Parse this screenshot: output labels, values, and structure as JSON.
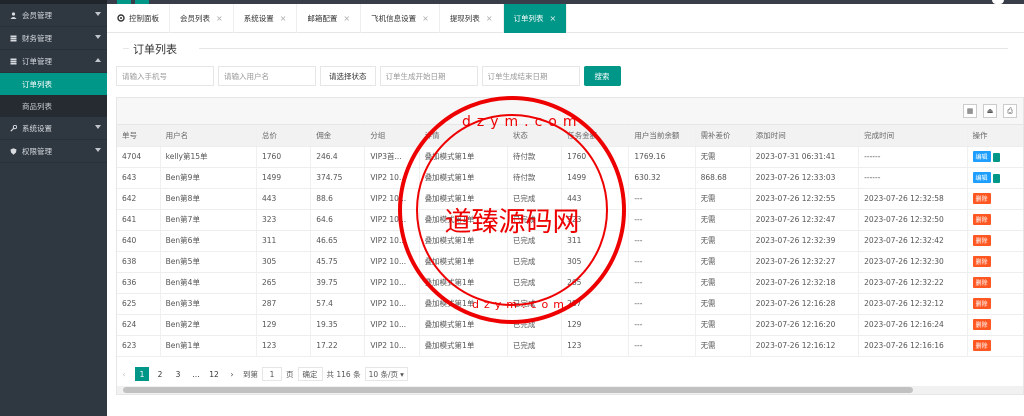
{
  "sidebar": {
    "items": [
      {
        "label": "会员管理"
      },
      {
        "label": "财务管理"
      },
      {
        "label": "订单管理"
      }
    ],
    "sub_items": [
      {
        "label": "订单列表"
      },
      {
        "label": "商品列表"
      }
    ],
    "after_items": [
      {
        "label": "系统设置"
      },
      {
        "label": "权限管理"
      }
    ]
  },
  "tabs": [
    {
      "label": "控制面板"
    },
    {
      "label": "会员列表"
    },
    {
      "label": "系统设置"
    },
    {
      "label": "邮箱配置"
    },
    {
      "label": "飞机信息设置"
    },
    {
      "label": "提现列表"
    },
    {
      "label": "订单列表"
    }
  ],
  "page": {
    "title": "订单列表"
  },
  "search": {
    "phone_placeholder": "请输入手机号",
    "user_placeholder": "请输入用户名",
    "status_label": "请选择状态",
    "start_placeholder": "订单生成开始日期",
    "end_placeholder": "订单生成结束日期",
    "submit": "搜索"
  },
  "table": {
    "headers": [
      "单号",
      "用户名",
      "总价",
      "佣金",
      "分组",
      "详情",
      "状态",
      "任务金额",
      "用户当前余额",
      "需补差价",
      "添加时间",
      "完成时间",
      "操作"
    ],
    "rows": [
      [
        "4704",
        "kelly第15单",
        "1760",
        "246.4",
        "VIP3首...",
        "叠加模式第1单",
        "待付款",
        "1760",
        "1769.16",
        "无需",
        "2023-07-31 06:31:41",
        "------"
      ],
      [
        "643",
        "Ben第9单",
        "1499",
        "374.75",
        "VIP2 10...",
        "叠加模式第1单",
        "待付款",
        "1499",
        "630.32",
        "868.68",
        "2023-07-26 12:33:03",
        "------"
      ],
      [
        "642",
        "Ben第8单",
        "443",
        "88.6",
        "VIP2 10...",
        "叠加模式第1单",
        "已完成",
        "443",
        "---",
        "无需",
        "2023-07-26 12:32:55",
        "2023-07-26 12:32:58"
      ],
      [
        "641",
        "Ben第7单",
        "323",
        "64.6",
        "VIP2 10...",
        "叠加模式第1单",
        "已完成",
        "323",
        "---",
        "无需",
        "2023-07-26 12:32:47",
        "2023-07-26 12:32:50"
      ],
      [
        "640",
        "Ben第6单",
        "311",
        "46.65",
        "VIP2 10...",
        "叠加模式第1单",
        "已完成",
        "311",
        "---",
        "无需",
        "2023-07-26 12:32:39",
        "2023-07-26 12:32:42"
      ],
      [
        "638",
        "Ben第5单",
        "305",
        "45.75",
        "VIP2 10...",
        "叠加模式第1单",
        "已完成",
        "305",
        "---",
        "无需",
        "2023-07-26 12:32:27",
        "2023-07-26 12:32:30"
      ],
      [
        "636",
        "Ben第4单",
        "265",
        "39.75",
        "VIP2 10...",
        "叠加模式第1单",
        "已完成",
        "265",
        "---",
        "无需",
        "2023-07-26 12:32:18",
        "2023-07-26 12:32:22"
      ],
      [
        "625",
        "Ben第3单",
        "287",
        "57.4",
        "VIP2 10...",
        "叠加模式第1单",
        "已完成",
        "287",
        "---",
        "无需",
        "2023-07-26 12:16:28",
        "2023-07-26 12:32:12"
      ],
      [
        "624",
        "Ben第2单",
        "129",
        "19.35",
        "VIP2 10...",
        "叠加模式第1单",
        "已完成",
        "129",
        "---",
        "无需",
        "2023-07-26 12:16:20",
        "2023-07-26 12:16:24"
      ],
      [
        "623",
        "Ben第1单",
        "123",
        "17.22",
        "VIP2 10...",
        "叠加模式第1单",
        "已完成",
        "123",
        "---",
        "无需",
        "2023-07-26 12:16:12",
        "2023-07-26 12:16:16"
      ]
    ],
    "op_edit": "编辑",
    "op_delete": "删除"
  },
  "pager": {
    "pages": [
      "1",
      "2",
      "3",
      "...",
      "12"
    ],
    "goto_label": "到第",
    "goto_value": "1",
    "page_unit": "页",
    "confirm": "确定",
    "total": "共 116 条",
    "page_size": "10 条/页"
  },
  "watermark": {
    "text": "道臻源码网",
    "top": "dzym.com",
    "bottom": "dzym.com"
  }
}
